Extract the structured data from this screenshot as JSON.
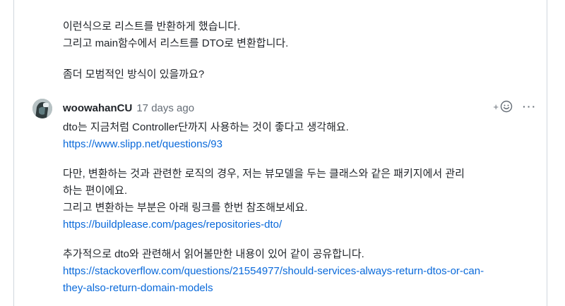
{
  "previous_comment": {
    "lines": [
      "이런식으로 리스트를 반환하게 했습니다.",
      "그리고 main함수에서 리스트를 DTO로 변환합니다."
    ],
    "question": "좀더 모범적인 방식이 있을까요?"
  },
  "reply": {
    "author": "woowahanCU",
    "time": "17 days ago",
    "icons": {
      "avatar": "avatar-image",
      "reaction": "add-reaction-smiley-icon",
      "more": "ellipsis-icon"
    },
    "reaction_plus": "+",
    "more_label": "···",
    "para1": "dto는 지금처럼 Controller단까지 사용하는 것이 좋다고 생각해요.",
    "link1": "https://www.slipp.net/questions/93",
    "para2_line1": "다만, 변환하는 것과 관련한 로직의 경우, 저는 뷰모델을 두는 클래스와 같은 패키지에서 관리",
    "para2_line2": "하는 편이에요.",
    "para2_line3": "그리고 변환하는 부분은 아래 링크를 한번 참조해보세요.",
    "link2": "https://buildplease.com/pages/repositories-dto/",
    "para3": "추가적으로 dto와 관련해서 읽어볼만한 내용이 있어 같이 공유합니다.",
    "link3_line1": "https://stackoverflow.com/questions/21554977/should-services-always-return-dtos-or-can-",
    "link3_line2": "they-also-return-domain-models"
  },
  "colors": {
    "link": "#0969da",
    "text": "#1f2328",
    "muted": "#656d76",
    "border": "#d0d7de"
  }
}
